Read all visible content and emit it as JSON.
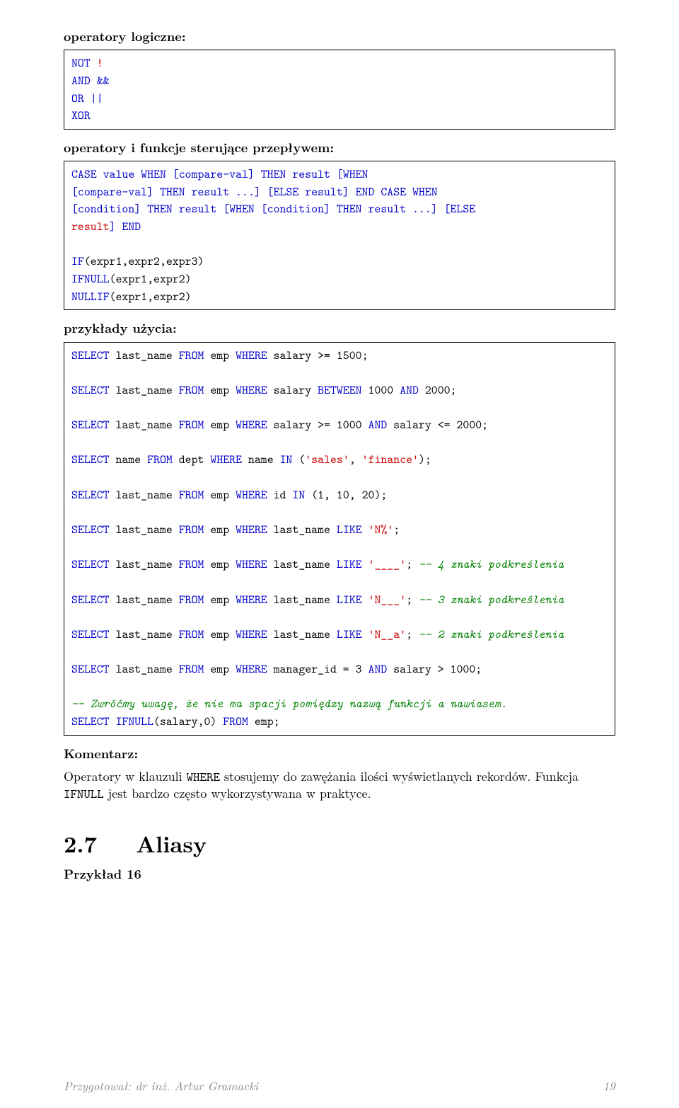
{
  "heading_ops": "operatory logiczne:",
  "box1": {
    "not": "NOT",
    "bang": "!",
    "and_amp": "AND &&",
    "or_pipe": "OR ||",
    "xor": "XOR"
  },
  "heading_flow": "operatory i funkcje sterujące przepływem:",
  "box2": {
    "case_l1": "CASE value WHEN [compare-val] THEN result [WHEN",
    "case_l2": "[compare-val] THEN result ...] [ELSE result] END CASE WHEN",
    "case_l3": "[condition] THEN result [WHEN [condition] THEN result ...] [ELSE",
    "case_l4_part1": "result",
    "case_l4_end": "] END",
    "blank": "",
    "if1": "IF",
    "if1_args": "(expr1,expr2,expr3)",
    "if2": "IFNULL",
    "if2_args": "(expr1,expr2)",
    "if3": "NULLIF",
    "if3_args": "(expr1,expr2)"
  },
  "heading_examples": "przykłady użycia:",
  "box3": {
    "q1": {
      "select": "SELECT",
      "c": " last_name ",
      "from": "FROM",
      "t": " emp ",
      "where": "WHERE",
      "rest": " salary >= 1500;"
    },
    "q2": {
      "select": "SELECT",
      "c": " last_name ",
      "from": "FROM",
      "t": " emp ",
      "where": "WHERE",
      "mid": " salary ",
      "between": "BETWEEN",
      "mid2": " 1000 ",
      "and": "AND",
      "end": " 2000;"
    },
    "q3": {
      "select": "SELECT",
      "c": " last_name ",
      "from": "FROM",
      "t": " emp ",
      "where": "WHERE",
      "mid": " salary >= 1000 ",
      "and": "AND",
      "end": " salary <= 2000;"
    },
    "q4": {
      "select": "SELECT",
      "c": " name ",
      "from": "FROM",
      "t": " dept ",
      "where": "WHERE",
      "mid": " name ",
      "in": "IN",
      "open": " (",
      "s1": "'sales'",
      "comma": ", ",
      "s2": "'finance'",
      "close": ");"
    },
    "q5": {
      "select": "SELECT",
      "c": " last_name ",
      "from": "FROM",
      "t": " emp ",
      "where": "WHERE",
      "mid": " id ",
      "in": "IN",
      "rest": " (1, 10, 20);"
    },
    "q6": {
      "select": "SELECT",
      "c": " last_name ",
      "from": "FROM",
      "t": " emp ",
      "where": "WHERE",
      "mid": " last_name ",
      "like": "LIKE",
      "sp": " ",
      "s": "'N%'",
      "semi": ";"
    },
    "q7": {
      "select": "SELECT",
      "c": " last_name ",
      "from": "FROM",
      "t": " emp ",
      "where": "WHERE",
      "mid": " last_name ",
      "like": "LIKE",
      "sp": " ",
      "s": "'____'",
      "semi": ";",
      "cmt": " -- 4 znaki podkreślenia"
    },
    "q8": {
      "select": "SELECT",
      "c": " last_name ",
      "from": "FROM",
      "t": " emp ",
      "where": "WHERE",
      "mid": " last_name ",
      "like": "LIKE",
      "sp": " ",
      "s": "'N___'",
      "semi": ";",
      "cmt": " -- 3 znaki podkreślenia"
    },
    "q9": {
      "select": "SELECT",
      "c": " last_name ",
      "from": "FROM",
      "t": " emp ",
      "where": "WHERE",
      "mid": " last_name ",
      "like": "LIKE",
      "sp": " ",
      "s": "'N__a'",
      "semi": ";",
      "cmt": " -- 2 znaki podkreślenia"
    },
    "q10": {
      "select": "SELECT",
      "c": " last_name ",
      "from": "FROM",
      "t": " emp ",
      "where": "WHERE",
      "mid": " manager_id = 3 ",
      "and": "AND",
      "end": " salary > 1000;"
    },
    "q11cmt": "-- Zwróćmy uwagę, że nie ma spacji pomiędzy nazwą funkcji a nawiasem.",
    "q11": {
      "select": "SELECT",
      "fn": " IFNULL",
      "args": "(salary,0) ",
      "from": "FROM",
      "end": " emp;"
    }
  },
  "heading_komentarz": "Komentarz:",
  "komentarz_p1a": "Operatory w klauzuli ",
  "komentarz_p1_code": "WHERE",
  "komentarz_p1b": " stosujemy do zawężania ilości wyświetlanych rekordów. Funkcja ",
  "komentarz_p1_code2": "IFNULL",
  "komentarz_p1c": " jest bardzo często wykorzystywana w praktyce.",
  "section_num": "2.7",
  "section_title": "Aliasy",
  "example_heading": "Przykład 16",
  "footer_left": "Przygotował: dr inż. Artur Gramacki",
  "footer_right": "19"
}
